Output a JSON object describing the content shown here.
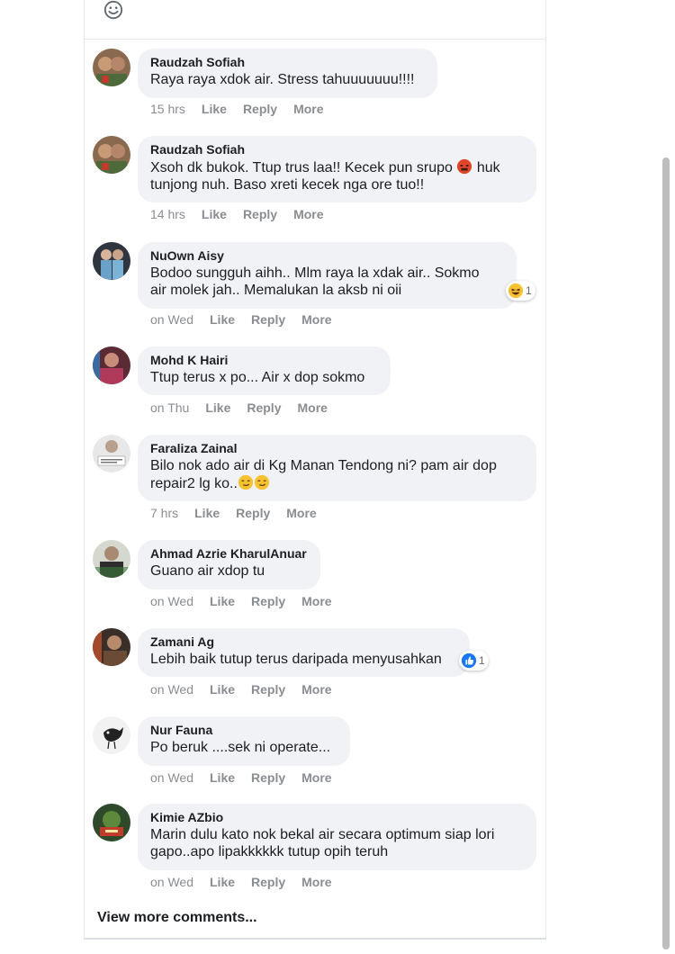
{
  "actions": {
    "like": "Like",
    "reply": "Reply",
    "more": "More"
  },
  "comments": [
    {
      "author": "Raudzah Sofiah",
      "text": "Raya raya xdok air. Stress tahuuuuuuu!!!!",
      "time": "15 hrs"
    },
    {
      "author": "Raudzah Sofiah",
      "text_line1": "Xsoh dk bukok. Ttup trus laa!! Kecek pun srupo",
      "text_line1_tail": "huk",
      "text_line2": "tunjong nuh. Baso xreti kecek nga ore tuo!!",
      "time": "14 hrs"
    },
    {
      "author": "NuOwn Aisy",
      "text_line1": "Bodoo sungguh aihh.. Mlm raya la xdak air.. Sokmo",
      "text_line2": "air molek jah.. Memalukan la aksb ni oii",
      "time": "on Wed",
      "reaction_count": "1"
    },
    {
      "author": "Mohd K Hairi",
      "text": "Ttup terus x po... Air x dop sokmo",
      "time": "on Thu"
    },
    {
      "author": "Faraliza Zainal",
      "text_line1": "Bilo nok ado air di Kg Manan Tendong ni? pam air dop",
      "text_line2": "repair2 lg ko..",
      "time": "7 hrs"
    },
    {
      "author": "Ahmad Azrie KharulAnuar",
      "text": "Guano air xdop tu",
      "time": "on Wed"
    },
    {
      "author": "Zamani Ag",
      "text": "Lebih baik tutup terus daripada menyusahkan",
      "time": "on Wed",
      "reaction_count": "1"
    },
    {
      "author": "Nur Fauna",
      "text": "Po beruk ....sek ni operate...",
      "time": "on Wed"
    },
    {
      "author": "Kimie AZbio",
      "text_line1": "Marin dulu kato nok bekal air secara optimum siap lori",
      "text_line2": "gapo..apo lipakkkkkk tutup opih teruh",
      "time": "on Wed"
    }
  ],
  "view_more": "View more comments...",
  "colors": {
    "bubble": "#f0f2f5",
    "meta": "#8a8d91",
    "like_blue": "#1877f2"
  }
}
